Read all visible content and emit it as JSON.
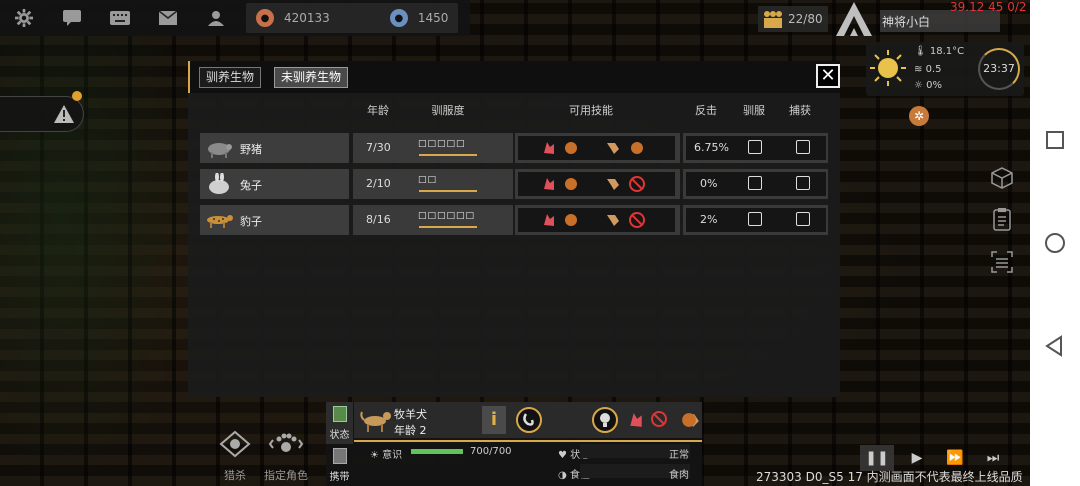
{
  "topbar": {
    "icons": [
      "gear-icon",
      "chat-icon",
      "keyboard-icon",
      "mail-icon",
      "profile-icon"
    ],
    "resource1_value": "420133",
    "resource2_value": "1450",
    "population": "22/80",
    "player_name": "神将小白",
    "ping": "39.12 45 0/2"
  },
  "weather": {
    "temperature": "18.1°C",
    "wind": "0.5",
    "rain": "0%",
    "clock": "23:37"
  },
  "panel": {
    "tab_tamed": "驯养生物",
    "tab_untamed": "未驯养生物",
    "close_symbol": "✕",
    "headers": {
      "age": "年龄",
      "taming": "驯服度",
      "skills": "可用技能",
      "counter": "反击",
      "tame": "驯服",
      "capture": "捕获"
    },
    "rows": [
      {
        "name": "野猪",
        "age": "7/30",
        "stars": "□□□□□",
        "taming_fill": 1.0,
        "counter": "6.75%",
        "blocked": false
      },
      {
        "name": "兔子",
        "age": "2/10",
        "stars": "□□",
        "taming_fill": 1.0,
        "counter": "0%",
        "blocked": true
      },
      {
        "name": "豹子",
        "age": "8/16",
        "stars": "□□□□□□",
        "taming_fill": 1.0,
        "counter": "2%",
        "blocked": true
      }
    ]
  },
  "bottom_actions": {
    "hunt": "猎杀",
    "assign": "指定角色"
  },
  "unit": {
    "tab_status": "状态",
    "tab_carry": "携带",
    "name": "牧羊犬",
    "age": "年龄 2",
    "info_symbol": "i",
    "stat_label": "意识",
    "stat_value": "700/700",
    "stat_fill": 1.0,
    "state_label": "状态",
    "state_value": "正常",
    "diet_label": "食性",
    "diet_value": "食肉"
  },
  "watermark": "273303 D0_S5 17  内测画面不代表最终上线品质",
  "colors": {
    "accent": "#d7a94a",
    "skill_red": "#e0505a",
    "skill_tan": "#d09a60",
    "health_green": "#5fc45a",
    "ping_red": "#e03535"
  }
}
